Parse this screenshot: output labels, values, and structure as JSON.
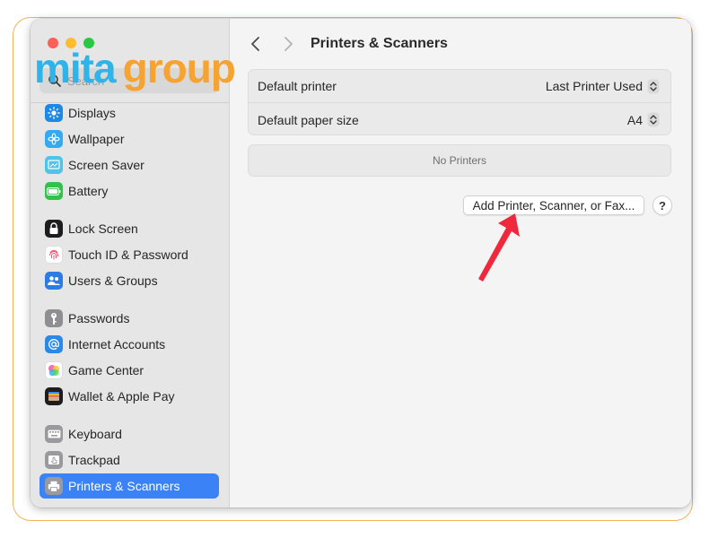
{
  "watermark": {
    "text": "mita group",
    "colors": {
      "primary": "#2fb4e9",
      "secondary": "#f6a331"
    }
  },
  "colors": {
    "accent": "#3b82f6",
    "frame": "#f2b25c",
    "arrow": "#f0283c"
  },
  "window": {
    "traffic_lights": [
      "close",
      "minimize",
      "zoom"
    ]
  },
  "sidebar": {
    "search": {
      "placeholder": "Search",
      "value": ""
    },
    "items": [
      {
        "label": "Displays",
        "icon": "sun-icon",
        "color": "#1e88e5"
      },
      {
        "label": "Wallpaper",
        "icon": "flower-icon",
        "color": "#35aaf0"
      },
      {
        "label": "Screen Saver",
        "icon": "screen-saver-icon",
        "color": "#4fc3e8"
      },
      {
        "label": "Battery",
        "icon": "battery-icon",
        "color": "#32c14a"
      },
      {
        "label": "Lock Screen",
        "icon": "lock-icon",
        "color": "#1d1d1f"
      },
      {
        "label": "Touch ID & Password",
        "icon": "fingerprint-icon",
        "color": "#ffffff"
      },
      {
        "label": "Users & Groups",
        "icon": "users-icon",
        "color": "#2d7be6"
      },
      {
        "label": "Passwords",
        "icon": "key-icon",
        "color": "#8e8e93"
      },
      {
        "label": "Internet Accounts",
        "icon": "at-sign-icon",
        "color": "#2b8ae8"
      },
      {
        "label": "Game Center",
        "icon": "game-center-icon",
        "color": "#ffffff"
      },
      {
        "label": "Wallet & Apple Pay",
        "icon": "wallet-icon",
        "color": "#1d1d1f"
      },
      {
        "label": "Keyboard",
        "icon": "keyboard-icon",
        "color": "#9a9a9e"
      },
      {
        "label": "Trackpad",
        "icon": "trackpad-icon",
        "color": "#9a9a9e"
      },
      {
        "label": "Printers & Scanners",
        "icon": "printer-icon",
        "color": "#9a9a9e",
        "selected": true
      }
    ]
  },
  "main": {
    "title": "Printers & Scanners",
    "settings": [
      {
        "label": "Default printer",
        "value": "Last Printer Used"
      },
      {
        "label": "Default paper size",
        "value": "A4"
      }
    ],
    "no_printers_text": "No Printers",
    "add_button_label": "Add Printer, Scanner, or Fax...",
    "help_button_label": "?"
  }
}
